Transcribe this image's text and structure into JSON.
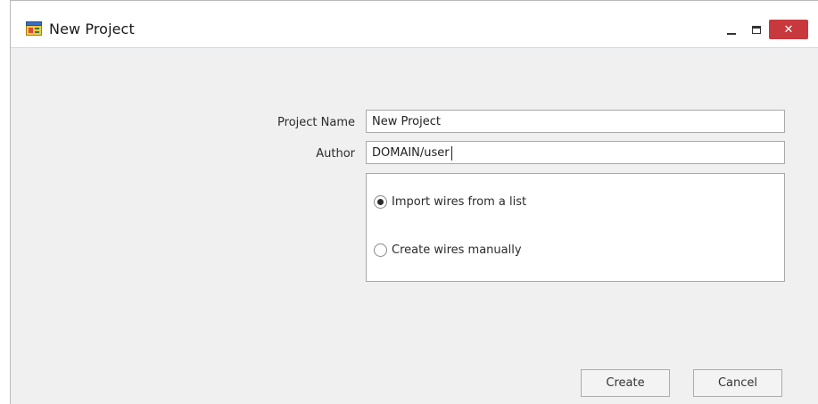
{
  "window": {
    "title": "New Project",
    "icon": "form-window-icon",
    "controls": {
      "minimize": "minimize-icon",
      "maximize": "maximize-icon",
      "close": "close-icon",
      "close_glyph": "✕",
      "close_color": "#c7393d"
    }
  },
  "form": {
    "project_name_label": "Project Name",
    "project_name_value": "New Project",
    "author_label": "Author",
    "author_value": "DOMAIN/user",
    "wire_options": [
      {
        "label": "Import wires from a list",
        "selected": true
      },
      {
        "label": "Create wires manually",
        "selected": false
      }
    ]
  },
  "buttons": {
    "create_label": "Create",
    "cancel_label": "Cancel"
  }
}
